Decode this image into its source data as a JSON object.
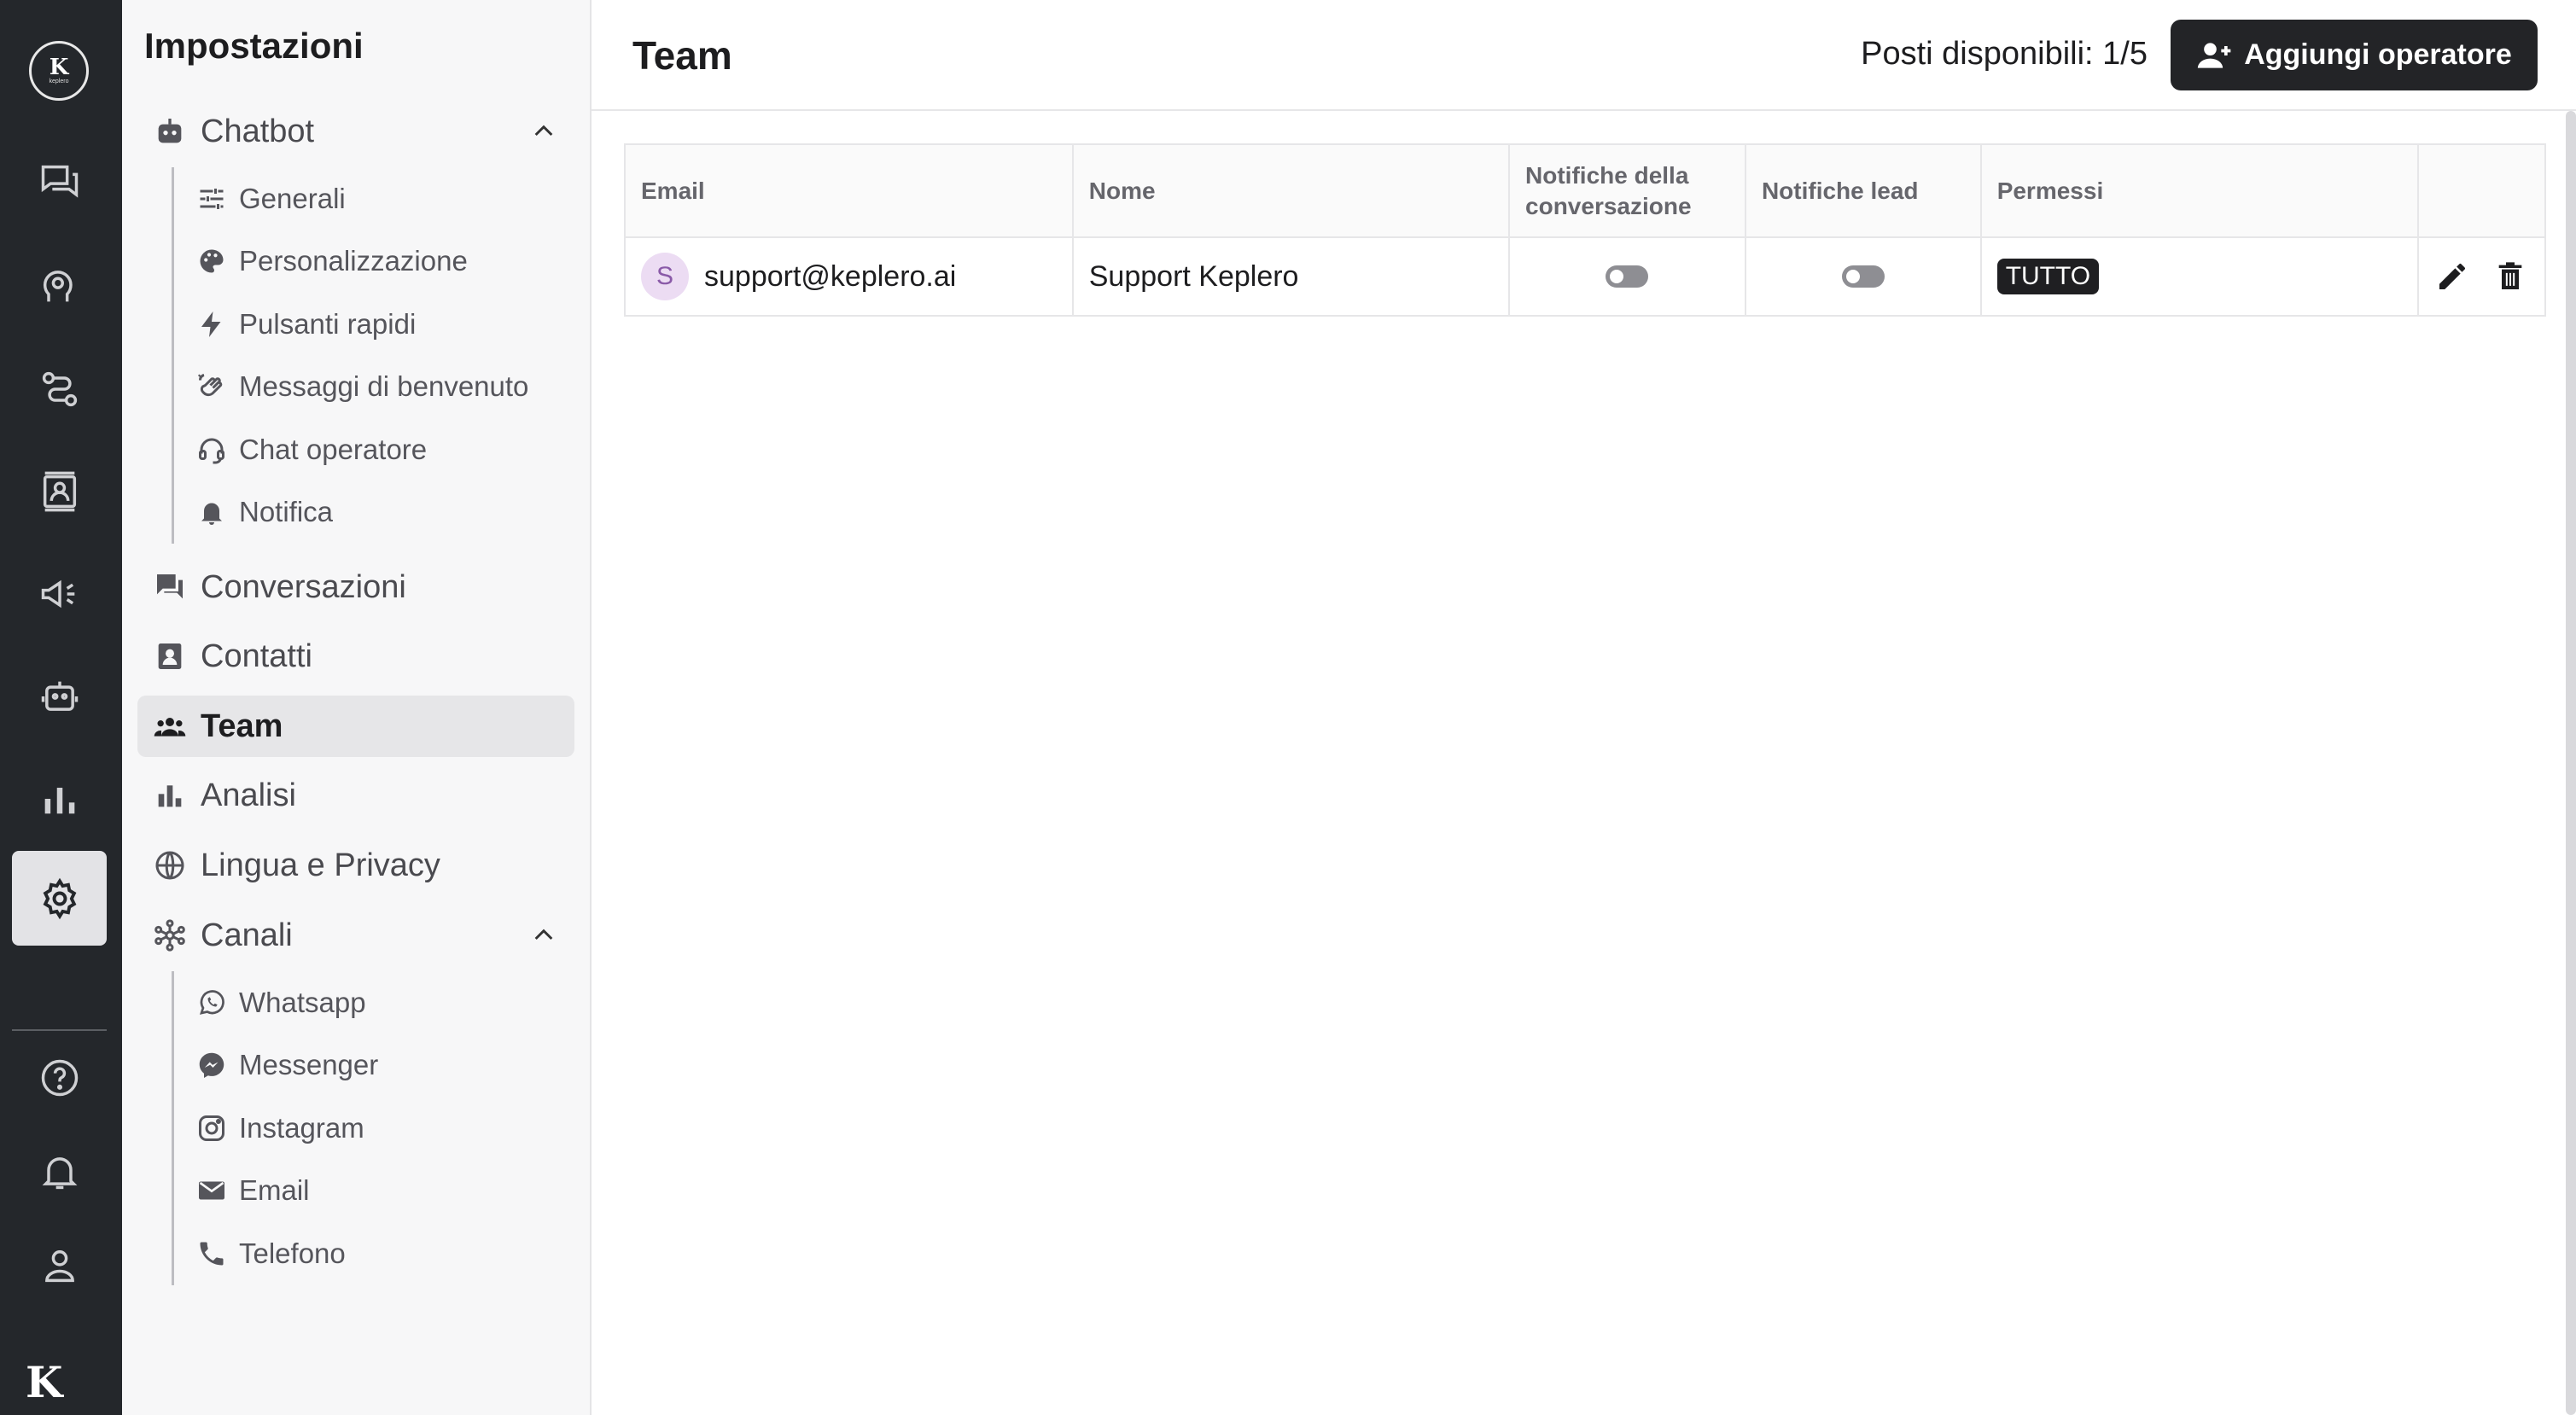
{
  "rail": {
    "logo_text": "K",
    "logo_sub": "keplero",
    "items": [
      {
        "name": "conversations-icon"
      },
      {
        "name": "ai-brain-icon"
      },
      {
        "name": "routes-icon"
      },
      {
        "name": "contacts-icon"
      },
      {
        "name": "campaigns-megaphone-icon"
      },
      {
        "name": "bot-icon"
      },
      {
        "name": "analytics-bar-icon"
      },
      {
        "name": "settings-gear-icon",
        "active": true
      }
    ],
    "bottom_items": [
      {
        "name": "help-icon"
      },
      {
        "name": "notifications-bell-icon"
      },
      {
        "name": "profile-icon"
      }
    ]
  },
  "panel": {
    "title": "Impostazioni",
    "chatbot": {
      "label": "Chatbot",
      "items": [
        {
          "label": "Generali",
          "icon": "sliders-icon"
        },
        {
          "label": "Personalizzazione",
          "icon": "palette-icon"
        },
        {
          "label": "Pulsanti rapidi",
          "icon": "lightning-icon"
        },
        {
          "label": "Messaggi di benvenuto",
          "icon": "waving-hand-icon"
        },
        {
          "label": "Chat operatore",
          "icon": "headset-icon"
        },
        {
          "label": "Notifica",
          "icon": "bell-icon"
        }
      ]
    },
    "conversazioni": "Conversazioni",
    "contatti": "Contatti",
    "team": "Team",
    "analisi": "Analisi",
    "lingua": "Lingua e Privacy",
    "canali": {
      "label": "Canali",
      "items": [
        {
          "label": "Whatsapp",
          "icon": "whatsapp-icon"
        },
        {
          "label": "Messenger",
          "icon": "messenger-icon"
        },
        {
          "label": "Instagram",
          "icon": "instagram-icon"
        },
        {
          "label": "Email",
          "icon": "mail-icon"
        },
        {
          "label": "Telefono",
          "icon": "phone-icon"
        }
      ]
    }
  },
  "main": {
    "title": "Team",
    "seats": "Posti disponibili: 1/5",
    "add_button": "Aggiungi operatore",
    "table": {
      "headers": {
        "email": "Email",
        "nome": "Nome",
        "notifiche_conversazione": "Notifiche della conversazione",
        "notifiche_lead": "Notifiche lead",
        "permessi": "Permessi"
      },
      "rows": [
        {
          "avatar": "S",
          "email": "support@keplero.ai",
          "nome": "Support Keplero",
          "notifiche_conversazione": false,
          "notifiche_lead": false,
          "permessi": "TUTTO"
        }
      ]
    }
  }
}
